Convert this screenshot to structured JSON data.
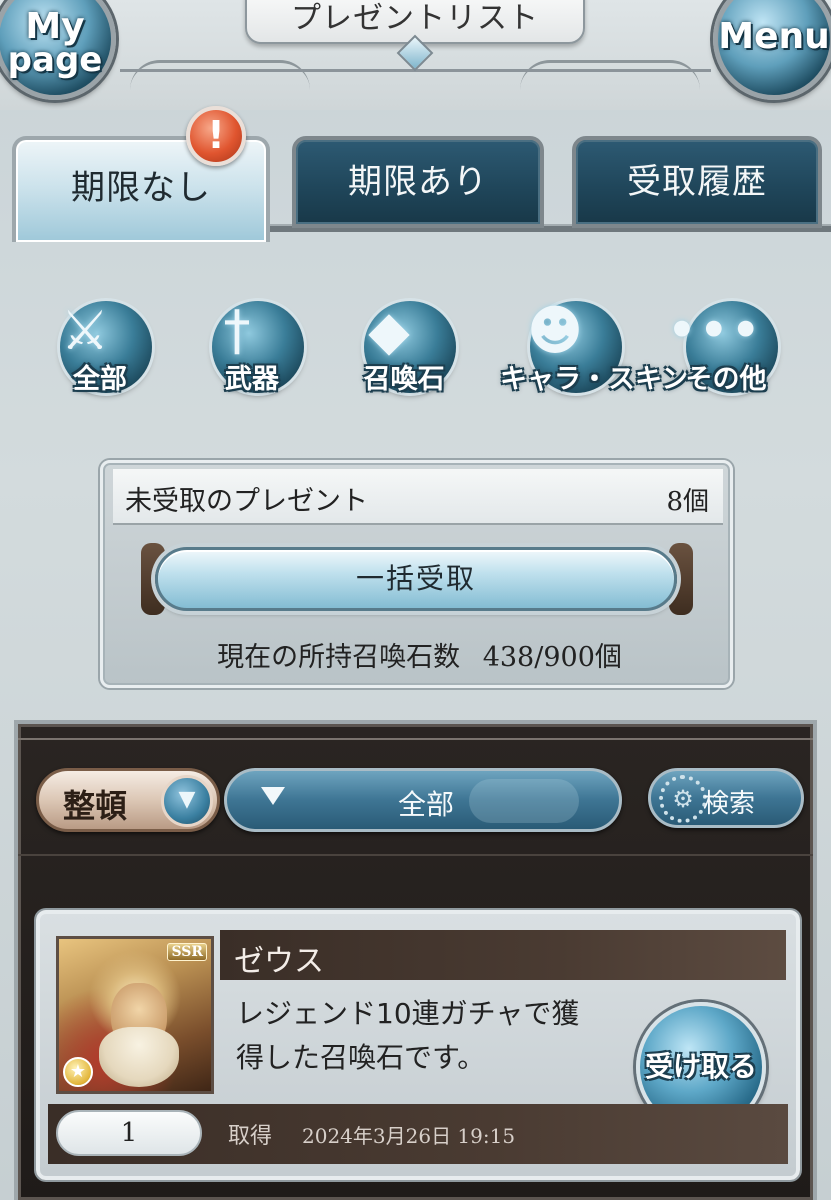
{
  "header": {
    "title": "プレゼントリスト",
    "mypage_line1": "My",
    "mypage_line2": "page",
    "menu_label": "Menu"
  },
  "tabs": [
    {
      "label": "期限なし",
      "active": true
    },
    {
      "label": "期限あり",
      "active": false
    },
    {
      "label": "受取履歴",
      "active": false
    }
  ],
  "alert_badge": "!",
  "categories": [
    {
      "label": "全部",
      "icon": "all-icon"
    },
    {
      "label": "武器",
      "icon": "weapon-icon"
    },
    {
      "label": "召喚石",
      "icon": "summon-icon"
    },
    {
      "label": "キャラ・スキン",
      "icon": "character-icon"
    },
    {
      "label": "その他",
      "icon": "other-icon"
    }
  ],
  "unclaimed": {
    "title": "未受取のプレゼント",
    "count": "8個",
    "bulk_button": "一括受取",
    "stone_label": "現在の所持召喚石数",
    "stone_value": "438/900個"
  },
  "controls": {
    "sort_label": "整頓",
    "filter_value": "全部",
    "search_label": "検索"
  },
  "present": {
    "name": "ゼウス",
    "rarity": "SSR",
    "description_line1": "レジェンド10連ガチャで獲",
    "description_line2": "得した召喚石です。",
    "receive_label": "受け取る",
    "quantity": "1",
    "acquired_label": "取得",
    "acquired_date": "2024年3月26日 19:15"
  },
  "colors": {
    "tab_active": "#cde3ec",
    "tab_inactive": "#1f4559",
    "panel_dark": "#1f1b19",
    "accent_blue": "#3e7594",
    "alert_red": "#e0552f"
  }
}
